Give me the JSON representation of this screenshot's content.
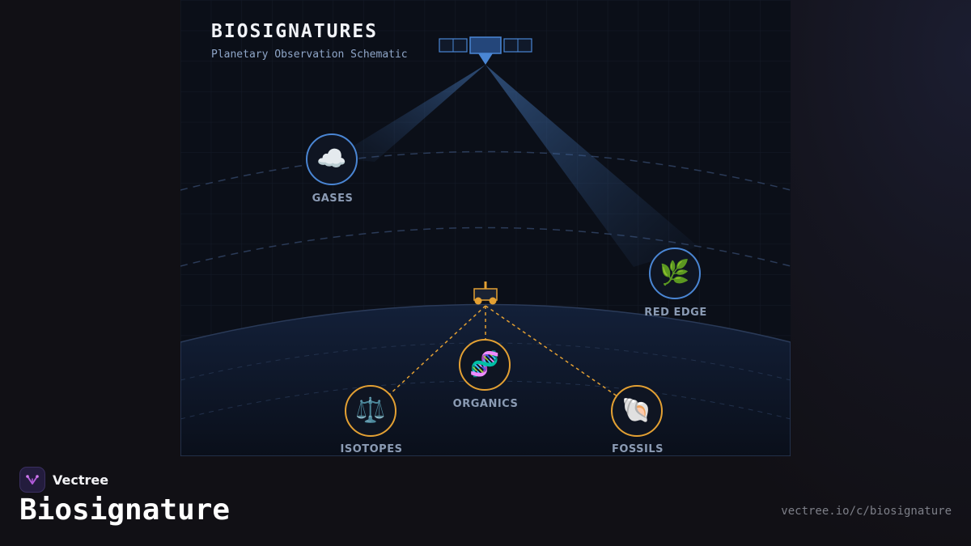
{
  "diagram": {
    "title": "BIOSIGNATURES",
    "subtitle": "Planetary Observation Schematic",
    "nodes": {
      "gases": {
        "label": "GASES",
        "icon": "cloud-icon",
        "glyph": "☁️",
        "ring_color": "#4a86d4"
      },
      "red_edge": {
        "label": "RED EDGE",
        "icon": "leaf-icon",
        "glyph": "🌿",
        "ring_color": "#4a86d4"
      },
      "organics": {
        "label": "ORGANICS",
        "icon": "dna-icon",
        "glyph": "🧬",
        "ring_color": "#e3a033"
      },
      "isotopes": {
        "label": "ISOTOPES",
        "icon": "scales-icon",
        "glyph": "⚖️",
        "ring_color": "#e3a033"
      },
      "fossils": {
        "label": "FOSSILS",
        "icon": "shell-icon",
        "glyph": "🐚",
        "ring_color": "#e3a033"
      }
    },
    "colors": {
      "remote_sensing": "#4a86d4",
      "in_situ": "#e3a033",
      "panel_background": "#0b0f18"
    }
  },
  "footer": {
    "brand_name": "Vectree",
    "page_title": "Biosignature",
    "url": "vectree.io/c/biosignature"
  }
}
